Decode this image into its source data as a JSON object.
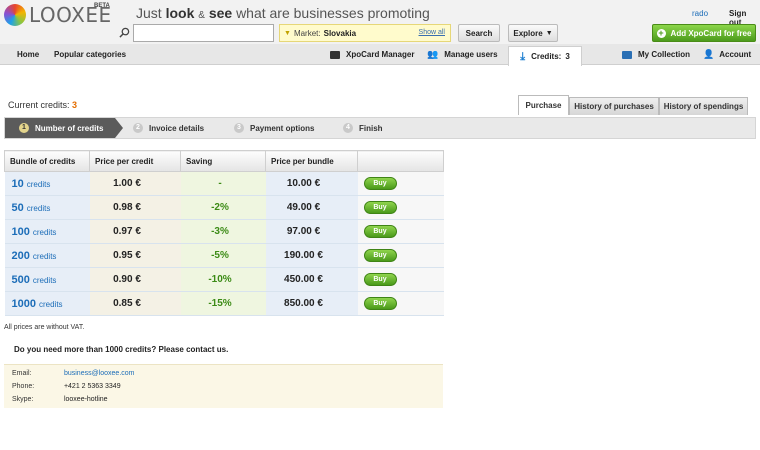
{
  "header": {
    "logo_text": "LOOXEE",
    "logo_badge": "BETA",
    "tagline": {
      "just": "Just",
      "look": "look",
      "amp": "&",
      "see": "see",
      "rest": "what are businesses promoting"
    },
    "search_placeholder": "",
    "market_label": "Market:",
    "market_value": "Slovakia",
    "market_show_all": "Show all",
    "search_button": "Search",
    "explore_button": "Explore",
    "user_name": "rado",
    "sign_out": "Sign out",
    "add_button": "Add XpoCard for free"
  },
  "nav": {
    "home": "Home",
    "popular": "Popular categories",
    "xpocard_manager": "XpoCard Manager",
    "manage_users": "Manage users",
    "credits_label": "Credits:",
    "credits_value": "3",
    "my_collection": "My Collection",
    "account": "Account"
  },
  "current_credits": {
    "label": "Current credits:",
    "value": "3"
  },
  "tabs": [
    "Purchase",
    "History of purchases",
    "History of spendings"
  ],
  "steps": [
    {
      "num": "1",
      "label": "Number of credits"
    },
    {
      "num": "2",
      "label": "Invoice details"
    },
    {
      "num": "3",
      "label": "Payment options"
    },
    {
      "num": "4",
      "label": "Finish"
    }
  ],
  "table": {
    "headers": [
      "Bundle of credits",
      "Price per credit",
      "Saving",
      "Price per bundle",
      ""
    ],
    "credits_word": "credits",
    "buy_label": "Buy",
    "rows": [
      {
        "credits": "10",
        "price": "1.00 €",
        "saving": "-",
        "bundle": "10.00 €"
      },
      {
        "credits": "50",
        "price": "0.98 €",
        "saving": "-2%",
        "bundle": "49.00 €"
      },
      {
        "credits": "100",
        "price": "0.97 €",
        "saving": "-3%",
        "bundle": "97.00 €"
      },
      {
        "credits": "200",
        "price": "0.95 €",
        "saving": "-5%",
        "bundle": "190.00 €"
      },
      {
        "credits": "500",
        "price": "0.90 €",
        "saving": "-10%",
        "bundle": "450.00 €"
      },
      {
        "credits": "1000",
        "price": "0.85 €",
        "saving": "-15%",
        "bundle": "850.00 €"
      }
    ]
  },
  "vat_note": "All prices are without VAT.",
  "more_note": "Do you need more than 1000 credits? Please contact us.",
  "contact": {
    "email_label": "Email:",
    "email": "business@looxee.com",
    "phone_label": "Phone:",
    "phone": "+421 2 5363 3349",
    "skype_label": "Skype:",
    "skype": "looxee-hotline"
  },
  "colors": {
    "accent_green": "#4c9b1c",
    "link_blue": "#1c6db8",
    "credits_orange": "#e36d00"
  }
}
